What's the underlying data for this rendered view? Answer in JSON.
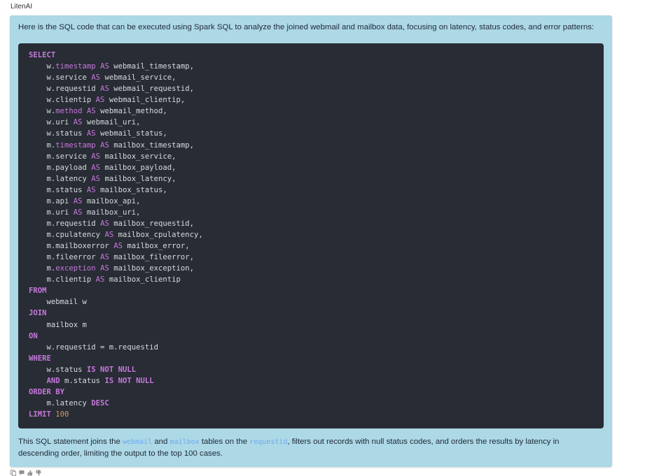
{
  "message": {
    "sender": "LitenAI",
    "intro": "Here is the SQL code that can be executed using Spark SQL to analyze the joined webmail and mailbox data, focusing on latency, status codes, and error patterns:",
    "code_lines": [
      [
        {
          "t": "SELECT",
          "c": "kw"
        }
      ],
      [
        {
          "t": "    w.",
          "c": "plain"
        },
        {
          "t": "timestamp",
          "c": "kwn"
        },
        {
          "t": " ",
          "c": "plain"
        },
        {
          "t": "AS",
          "c": "kwn"
        },
        {
          "t": " webmail_timestamp,",
          "c": "plain"
        }
      ],
      [
        {
          "t": "    w.service ",
          "c": "plain"
        },
        {
          "t": "AS",
          "c": "kwn"
        },
        {
          "t": " webmail_service,",
          "c": "plain"
        }
      ],
      [
        {
          "t": "    w.requestid ",
          "c": "plain"
        },
        {
          "t": "AS",
          "c": "kwn"
        },
        {
          "t": " webmail_requestid,",
          "c": "plain"
        }
      ],
      [
        {
          "t": "    w.clientip ",
          "c": "plain"
        },
        {
          "t": "AS",
          "c": "kwn"
        },
        {
          "t": " webmail_clientip,",
          "c": "plain"
        }
      ],
      [
        {
          "t": "    w.",
          "c": "plain"
        },
        {
          "t": "method",
          "c": "kwn"
        },
        {
          "t": " ",
          "c": "plain"
        },
        {
          "t": "AS",
          "c": "kwn"
        },
        {
          "t": " webmail_method,",
          "c": "plain"
        }
      ],
      [
        {
          "t": "    w.uri ",
          "c": "plain"
        },
        {
          "t": "AS",
          "c": "kwn"
        },
        {
          "t": " webmail_uri,",
          "c": "plain"
        }
      ],
      [
        {
          "t": "    w.status ",
          "c": "plain"
        },
        {
          "t": "AS",
          "c": "kwn"
        },
        {
          "t": " webmail_status,",
          "c": "plain"
        }
      ],
      [
        {
          "t": "    m.",
          "c": "plain"
        },
        {
          "t": "timestamp",
          "c": "kwn"
        },
        {
          "t": " ",
          "c": "plain"
        },
        {
          "t": "AS",
          "c": "kwn"
        },
        {
          "t": " mailbox_timestamp,",
          "c": "plain"
        }
      ],
      [
        {
          "t": "    m.service ",
          "c": "plain"
        },
        {
          "t": "AS",
          "c": "kwn"
        },
        {
          "t": " mailbox_service,",
          "c": "plain"
        }
      ],
      [
        {
          "t": "    m.payload ",
          "c": "plain"
        },
        {
          "t": "AS",
          "c": "kwn"
        },
        {
          "t": " mailbox_payload,",
          "c": "plain"
        }
      ],
      [
        {
          "t": "    m.latency ",
          "c": "plain"
        },
        {
          "t": "AS",
          "c": "kwn"
        },
        {
          "t": " mailbox_latency,",
          "c": "plain"
        }
      ],
      [
        {
          "t": "    m.status ",
          "c": "plain"
        },
        {
          "t": "AS",
          "c": "kwn"
        },
        {
          "t": " mailbox_status,",
          "c": "plain"
        }
      ],
      [
        {
          "t": "    m.api ",
          "c": "plain"
        },
        {
          "t": "AS",
          "c": "kwn"
        },
        {
          "t": " mailbox_api,",
          "c": "plain"
        }
      ],
      [
        {
          "t": "    m.uri ",
          "c": "plain"
        },
        {
          "t": "AS",
          "c": "kwn"
        },
        {
          "t": " mailbox_uri,",
          "c": "plain"
        }
      ],
      [
        {
          "t": "    m.requestid ",
          "c": "plain"
        },
        {
          "t": "AS",
          "c": "kwn"
        },
        {
          "t": " mailbox_requestid,",
          "c": "plain"
        }
      ],
      [
        {
          "t": "    m.cpulatency ",
          "c": "plain"
        },
        {
          "t": "AS",
          "c": "kwn"
        },
        {
          "t": " mailbox_cpulatency,",
          "c": "plain"
        }
      ],
      [
        {
          "t": "    m.mailboxerror ",
          "c": "plain"
        },
        {
          "t": "AS",
          "c": "kwn"
        },
        {
          "t": " mailbox_error,",
          "c": "plain"
        }
      ],
      [
        {
          "t": "    m.fileerror ",
          "c": "plain"
        },
        {
          "t": "AS",
          "c": "kwn"
        },
        {
          "t": " mailbox_fileerror,",
          "c": "plain"
        }
      ],
      [
        {
          "t": "    m.",
          "c": "plain"
        },
        {
          "t": "exception",
          "c": "kwn"
        },
        {
          "t": " ",
          "c": "plain"
        },
        {
          "t": "AS",
          "c": "kwn"
        },
        {
          "t": " mailbox_exception,",
          "c": "plain"
        }
      ],
      [
        {
          "t": "    m.clientip ",
          "c": "plain"
        },
        {
          "t": "AS",
          "c": "kwn"
        },
        {
          "t": " mailbox_clientip",
          "c": "plain"
        }
      ],
      [
        {
          "t": "FROM",
          "c": "kw"
        }
      ],
      [
        {
          "t": "    webmail w",
          "c": "plain"
        }
      ],
      [
        {
          "t": "JOIN",
          "c": "kw"
        }
      ],
      [
        {
          "t": "    mailbox m",
          "c": "plain"
        }
      ],
      [
        {
          "t": "ON",
          "c": "kw"
        }
      ],
      [
        {
          "t": "    w.requestid = m.requestid",
          "c": "plain"
        }
      ],
      [
        {
          "t": "WHERE",
          "c": "kw"
        }
      ],
      [
        {
          "t": "    w.status ",
          "c": "plain"
        },
        {
          "t": "IS NOT NULL",
          "c": "kw"
        }
      ],
      [
        {
          "t": "    ",
          "c": "plain"
        },
        {
          "t": "AND",
          "c": "kw"
        },
        {
          "t": " m.status ",
          "c": "plain"
        },
        {
          "t": "IS NOT NULL",
          "c": "kw"
        }
      ],
      [
        {
          "t": "ORDER BY",
          "c": "kw"
        }
      ],
      [
        {
          "t": "    m.latency ",
          "c": "plain"
        },
        {
          "t": "DESC",
          "c": "kw"
        }
      ],
      [
        {
          "t": "LIMIT",
          "c": "kw"
        },
        {
          "t": " ",
          "c": "plain"
        },
        {
          "t": "100",
          "c": "num"
        }
      ]
    ],
    "outro": {
      "part1": "This SQL statement joins the ",
      "code1": "webmail",
      "part2": " and ",
      "code2": "mailbox",
      "part3": " tables on the ",
      "code3": "requestid",
      "part4": ", filters out records with null status codes, and orders the results by latency in descending order, limiting the output to the top 100 cases."
    },
    "actions": [
      {
        "name": "copy-icon",
        "icon": "copy"
      },
      {
        "name": "comment-icon",
        "icon": "speech-bubble"
      },
      {
        "name": "thumbs-up-icon",
        "icon": "thumbs-up"
      },
      {
        "name": "thumbs-down-icon",
        "icon": "thumbs-down"
      }
    ]
  },
  "colors": {
    "bubble_bg": "#add8e6",
    "code_bg": "#282c34",
    "keyword": "#c678dd",
    "number": "#d19a66",
    "code_text": "#d7dae0",
    "inline_code": "#6aa9f0"
  }
}
